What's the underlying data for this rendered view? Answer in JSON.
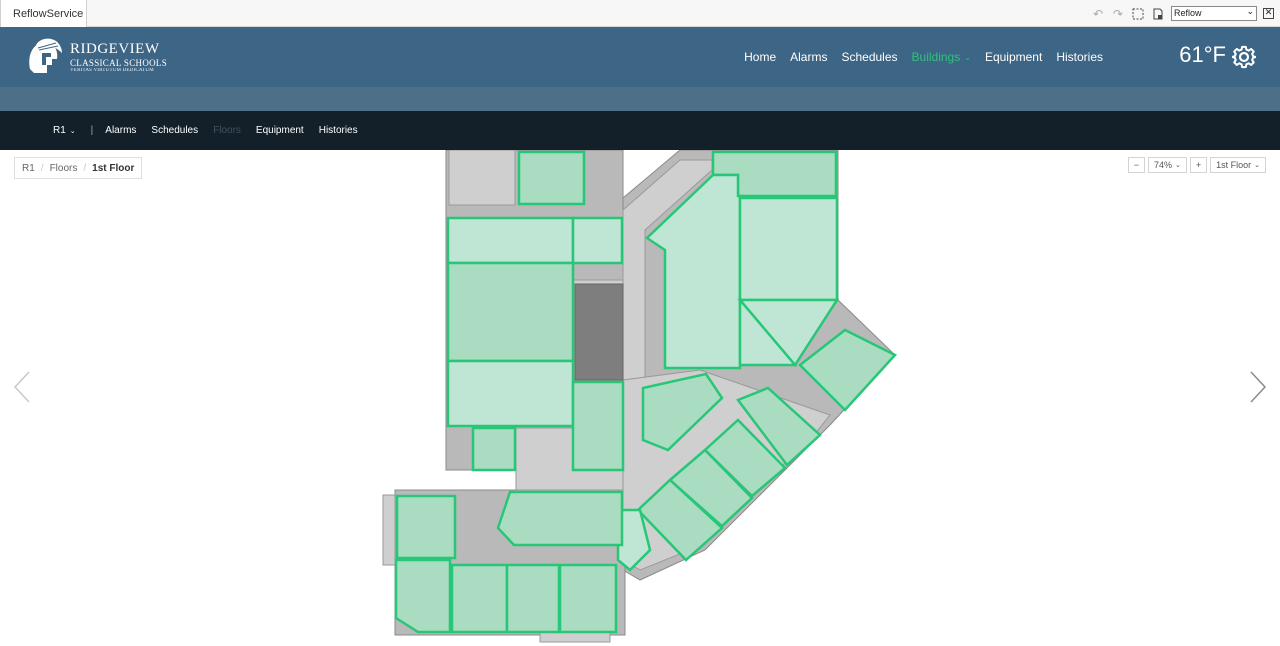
{
  "tabstrip": {
    "tab_label": "ReflowService",
    "view_select_value": "Reflow",
    "icons": [
      "undo-icon",
      "redo-icon",
      "select-area-icon",
      "document-icon",
      "close-icon"
    ]
  },
  "header": {
    "logo": {
      "line1": "RIDGEVIEW",
      "line2": "CLASSICAL SCHOOLS",
      "line3": "VERITAS VIRTUTUM DEDICATUM"
    },
    "nav": [
      {
        "label": "Home",
        "active": false
      },
      {
        "label": "Alarms",
        "active": false
      },
      {
        "label": "Schedules",
        "active": false
      },
      {
        "label": "Buildings",
        "active": true,
        "dropdown": true
      },
      {
        "label": "Equipment",
        "active": false
      },
      {
        "label": "Histories",
        "active": false
      }
    ],
    "temperature": "61°F",
    "accent_color": "#2ec27e",
    "bg_color": "#3d6585"
  },
  "subnav": {
    "building": "R1",
    "items": [
      {
        "label": "Alarms",
        "muted": false
      },
      {
        "label": "Schedules",
        "muted": false
      },
      {
        "label": "Floors",
        "muted": true
      },
      {
        "label": "Equipment",
        "muted": false
      },
      {
        "label": "Histories",
        "muted": false
      }
    ]
  },
  "breadcrumb": {
    "items": [
      "R1",
      "Floors"
    ],
    "current": "1st Floor"
  },
  "zoom": {
    "minus": "−",
    "level": "74%",
    "plus": "+",
    "floor": "1st Floor"
  },
  "colors": {
    "room_fill": "#a9dcc0",
    "room_outline": "#27c777"
  }
}
